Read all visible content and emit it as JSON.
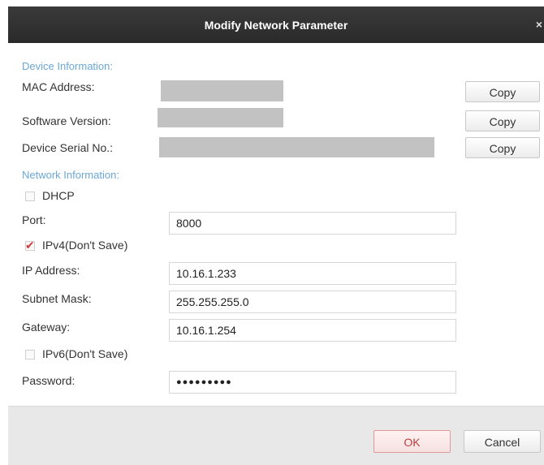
{
  "dialog": {
    "title": "Modify Network Parameter",
    "close_glyph": "×"
  },
  "device_info": {
    "section_title": "Device Information:",
    "mac_label": "MAC Address:",
    "software_label": "Software Version:",
    "serial_label": "Device Serial No.:",
    "copy_label": "Copy"
  },
  "network_info": {
    "section_title": "Network Information:",
    "dhcp_label": "DHCP",
    "dhcp_checked": false,
    "port_label": "Port:",
    "port_value": "8000",
    "ipv4_label": "IPv4(Don't Save)",
    "ipv4_checked": true,
    "ip_label": "IP Address:",
    "ip_value": "10.16.1.233",
    "subnet_label": "Subnet Mask:",
    "subnet_value": "255.255.255.0",
    "gateway_label": "Gateway:",
    "gateway_value": "10.16.1.254",
    "ipv6_label": "IPv6(Don't Save)",
    "ipv6_checked": false,
    "password_label": "Password:",
    "password_value": "●●●●●●●●●"
  },
  "footer": {
    "ok_label": "OK",
    "cancel_label": "Cancel"
  },
  "colors": {
    "titlebar": "#2f2f2f",
    "section": "#6ba7d6",
    "check": "#d23c3c"
  }
}
